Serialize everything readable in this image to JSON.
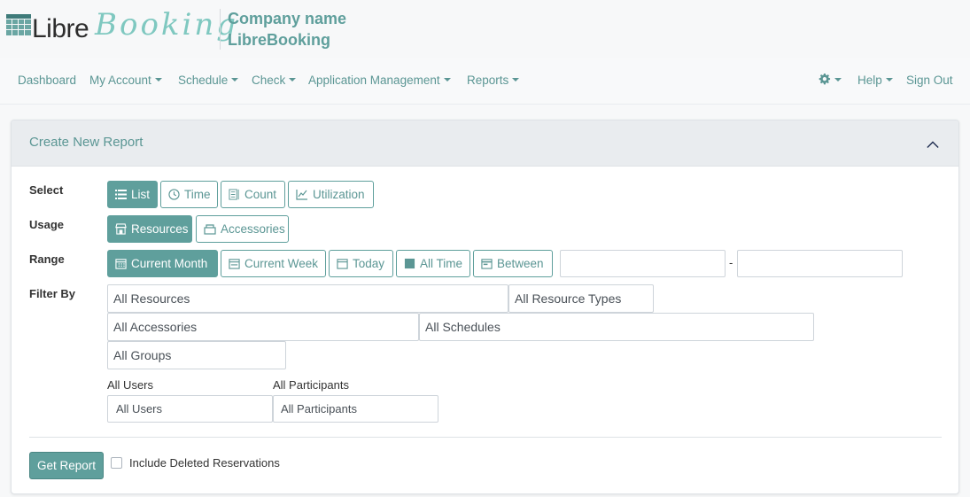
{
  "brand": {
    "logo_libre": "Libre",
    "logo_booking": "Booking",
    "company_line1": "Company name",
    "company_line2": "LibreBooking",
    "accent": "#5f9f9c"
  },
  "nav": {
    "dashboard": "Dashboard",
    "my_account": "My Account",
    "schedule": "Schedule",
    "check": "Check",
    "app_management": "Application Management",
    "reports": "Reports",
    "settings_icon": "gear-icon",
    "help": "Help",
    "sign_out": "Sign Out"
  },
  "card": {
    "title": "Create New Report"
  },
  "select": {
    "label": "Select",
    "options": [
      "List",
      "Time",
      "Count",
      "Utilization"
    ],
    "selected": "List"
  },
  "usage": {
    "label": "Usage",
    "options": [
      "Resources",
      "Accessories"
    ],
    "selected": "Resources"
  },
  "range": {
    "label": "Range",
    "options": [
      "Current Month",
      "Current Week",
      "Today",
      "All Time",
      "Between"
    ],
    "selected": "Current Month",
    "separator": "-",
    "start_value": "",
    "end_value": ""
  },
  "filter": {
    "label": "Filter By",
    "resources": "All Resources",
    "resource_types": "All Resource Types",
    "accessories": "All Accessories",
    "schedules": "All Schedules",
    "groups": "All Groups",
    "users_label": "All Users",
    "users_value": "All Users",
    "participants_label": "All Participants",
    "participants_value": "All Participants"
  },
  "footer": {
    "get_report": "Get Report",
    "include_deleted": "Include Deleted Reservations",
    "include_deleted_checked": false
  }
}
